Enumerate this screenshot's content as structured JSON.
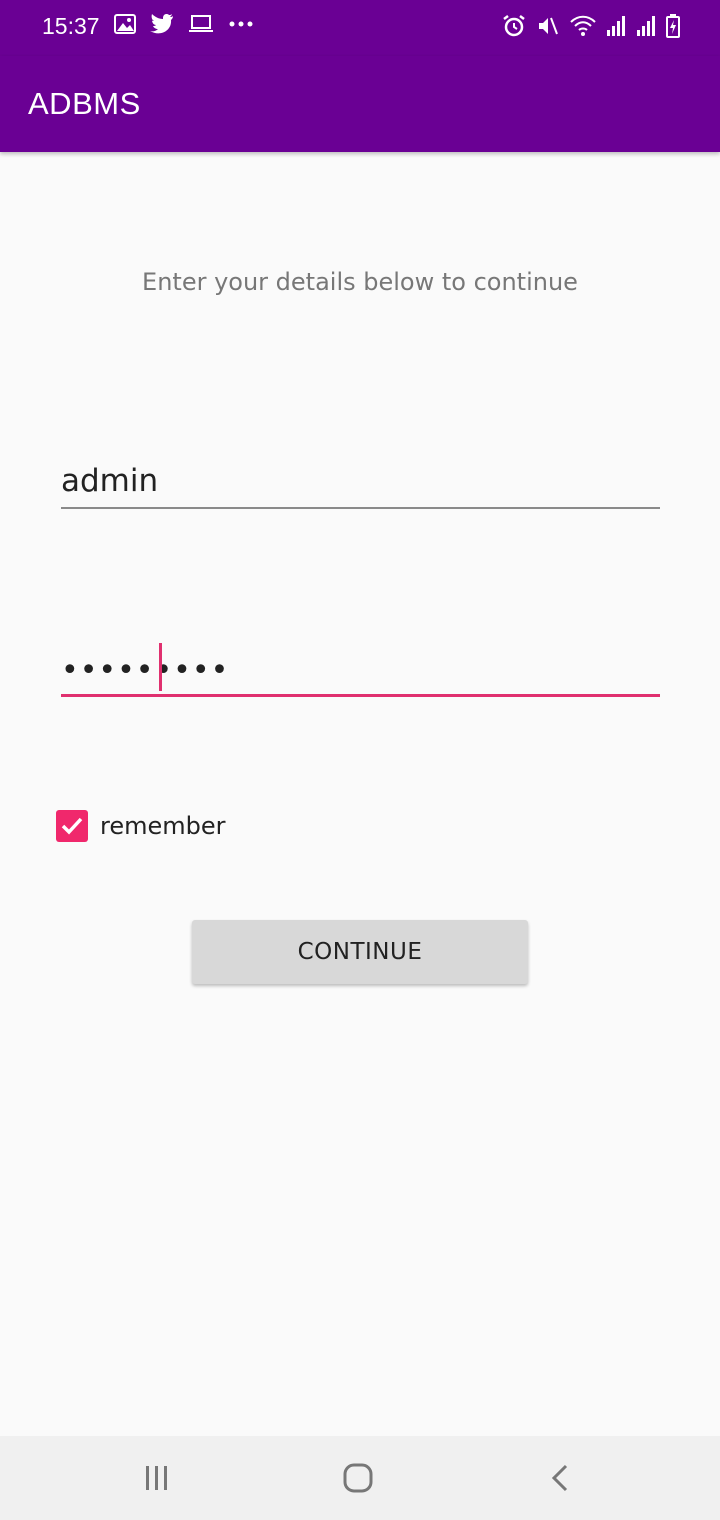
{
  "status_bar": {
    "time": "15:37",
    "left_icons": [
      "image-icon",
      "twitter-icon",
      "laptop-icon",
      "more-dots-icon"
    ],
    "right_icons": [
      "alarm-icon",
      "mute-icon",
      "wifi-icon",
      "signal-icon",
      "signal-icon",
      "battery-icon"
    ]
  },
  "app_bar": {
    "title": "ADBMS"
  },
  "form": {
    "subtitle": "Enter your details below to continue",
    "username_value": "admin",
    "password_value": "•••••••••",
    "remember_label": "remember",
    "remember_checked": true,
    "continue_label": "CONTINUE"
  },
  "nav_bar": {
    "buttons": [
      "recents-icon",
      "home-icon",
      "back-icon"
    ]
  },
  "colors": {
    "primary": "#6a0094",
    "accent": "#f0286c",
    "background": "#fafafa"
  }
}
